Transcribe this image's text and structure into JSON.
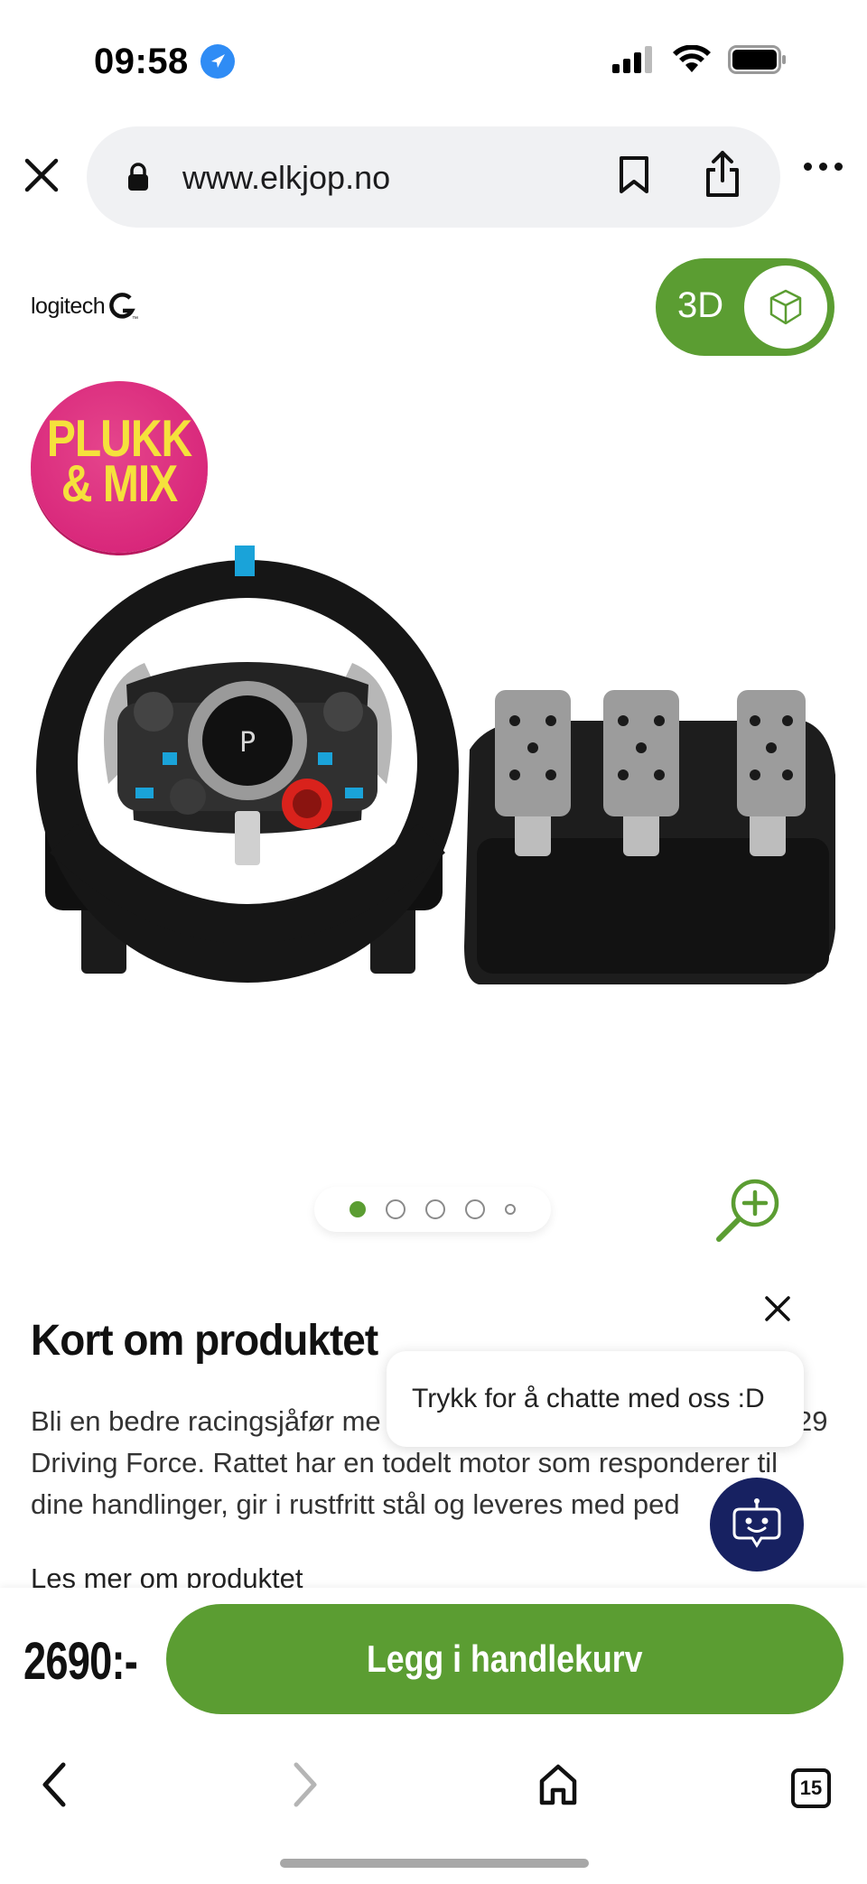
{
  "status_bar": {
    "time": "09:58"
  },
  "browser": {
    "url": "www.elkjop.no",
    "tab_count": "15"
  },
  "product": {
    "brand": "logitech",
    "toggle_3d_label": "3D",
    "promo_badge": [
      "PLUKK",
      "& MIX"
    ],
    "carousel": {
      "total": 5,
      "active_index": 0
    },
    "section_title": "Kort om produktet",
    "description_lines": [
      "Bli en bedre racingsjåfør me",
      "29",
      "Driving Force. Rattet har en todelt motor som responderer til",
      "dine handlinger, gir i rustfritt stål og leveres med ped"
    ],
    "read_more": "Les mer om produktet",
    "price": "2690:-",
    "add_to_cart": "Legg i handlekurv"
  },
  "chat": {
    "prompt": "Trykk for å chatte med oss :D"
  },
  "colors": {
    "brand_green": "#5b9d32",
    "chat_navy": "#172161",
    "promo_pink": "#d8267a",
    "promo_yellow": "#f5e13c"
  }
}
